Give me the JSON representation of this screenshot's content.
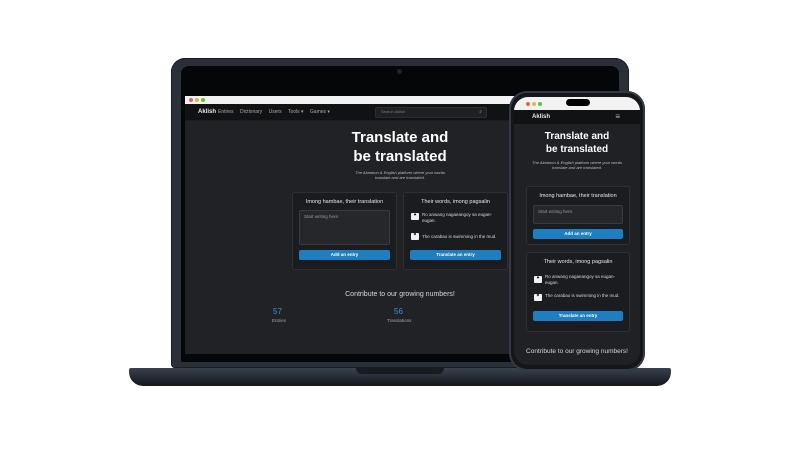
{
  "brand": "Aklish",
  "nav": {
    "links": [
      "Entries",
      "Dictionary",
      "Users",
      "Tools ▾",
      "Games ▾"
    ],
    "search_placeholder": "Search Aklish"
  },
  "hero": {
    "title_line1": "Translate and",
    "title_line2": "be translated",
    "subtitle": "The Akeanon & English platform where your words translate and are translated."
  },
  "entry_card": {
    "title": "Imong hambae, their translation",
    "placeholder": "Start writing here.",
    "button": "Add an entry"
  },
  "translate_card": {
    "title": "Their words, imong pagsalin",
    "source_text": "Ro anwang nagaeangoy sa eugan-eugan.",
    "target_text": "The carabao is swimming in the mud.",
    "button": "Translate an entry"
  },
  "contribute": {
    "heading": "Contribute to our growing numbers!",
    "entries_count": "57",
    "entries_label": "Entries",
    "translations_count": "56",
    "translations_label": "Translations"
  },
  "colors": {
    "accent": "#1d7fc1",
    "stat": "#3d8fd0",
    "background": "#212226"
  },
  "icons": {
    "search": "magnifier-icon",
    "menu": "hamburger-icon",
    "quote_open": "quote-open-icon",
    "quote_close": "quote-close-icon"
  }
}
